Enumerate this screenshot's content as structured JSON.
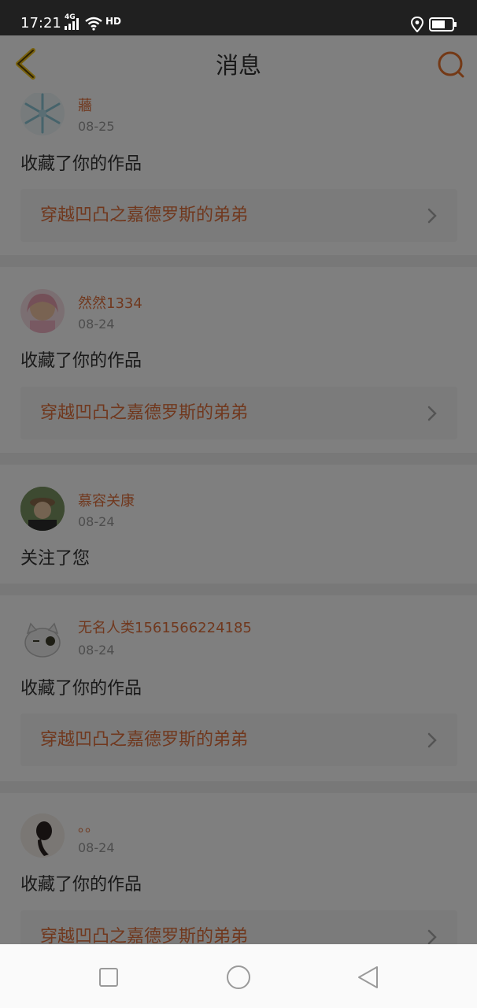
{
  "status_bar": {
    "time": "17:21",
    "network": "4G",
    "hd": "HD"
  },
  "header": {
    "title": "消息",
    "back_icon": "chevron-left-icon",
    "search_icon": "search-icon"
  },
  "messages": [
    {
      "user": "蘠",
      "date": "08-25",
      "action": "收藏了你的作品",
      "work_title": "穿越凹凸之嘉德罗斯的弟弟"
    },
    {
      "user": "然然1334",
      "date": "08-24",
      "action": "收藏了你的作品",
      "work_title": "穿越凹凸之嘉德罗斯的弟弟"
    },
    {
      "user": "慕容关康",
      "date": "08-24",
      "action": "关注了您"
    },
    {
      "user": "无名人类1561566224185",
      "date": "08-24",
      "action": "收藏了你的作品",
      "work_title": "穿越凹凸之嘉德罗斯的弟弟"
    },
    {
      "user": "。。",
      "date": "08-24",
      "action": "收藏了你的作品",
      "work_title": "穿越凹凸之嘉德罗斯的弟弟"
    }
  ],
  "colors": {
    "accent": "#e0703d",
    "status_bar": "#202020",
    "overlay": "rgba(0,0,0,0.5)"
  },
  "nav_bar": {
    "icons": [
      "recent-apps-icon",
      "home-icon",
      "back-icon"
    ]
  }
}
